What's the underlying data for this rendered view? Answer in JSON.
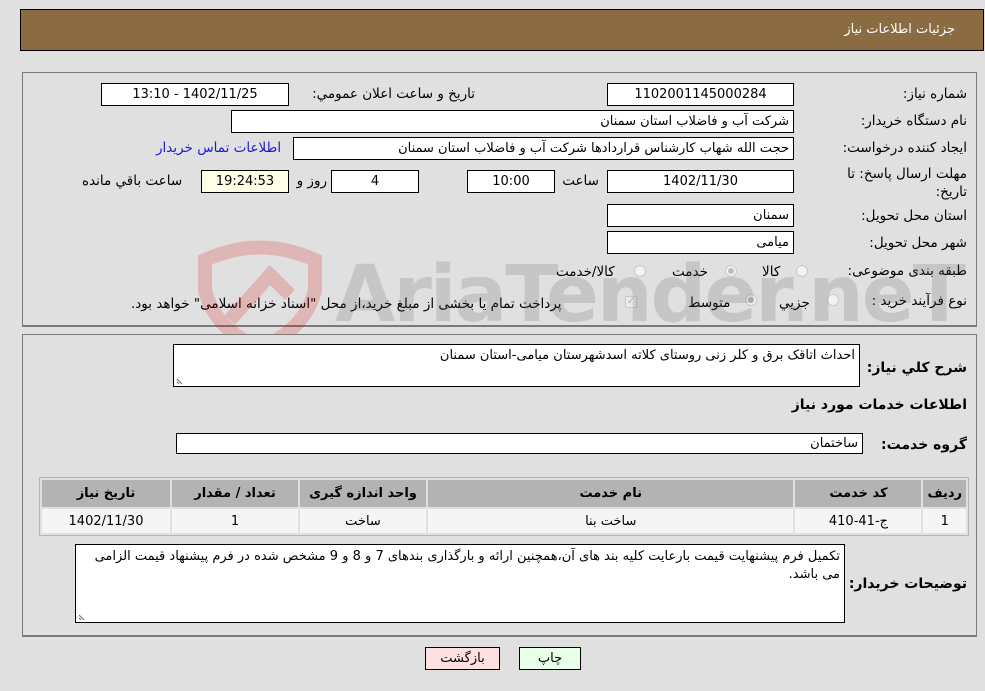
{
  "header": {
    "title": "جزئیات اطلاعات نیاز"
  },
  "details": {
    "need_number_label": "شماره نیاز:",
    "need_number": "1102001145000284",
    "announce_label": "تاریخ و ساعت اعلان عمومي:",
    "announce_value": "1402/11/25 - 13:10",
    "buyer_org_label": "نام دستگاه خریدار:",
    "buyer_org": "شرکت آب و فاضلاب استان سمنان",
    "requester_label": "ایجاد کننده درخواست:",
    "requester": "حجت الله شهاب کارشناس قراردادها شرکت آب و فاضلاب استان سمنان",
    "buyer_contact_link": "اطلاعات تماس خریدار",
    "deadline_label_line1": "مهلت ارسال پاسخ: تا",
    "deadline_label_line2": "تاریخ:",
    "deadline_date": "1402/11/30",
    "time_label": "ساعت",
    "deadline_time": "10:00",
    "days_value": "4",
    "days_label": "روز و",
    "remaining_time": "19:24:53",
    "remaining_label": "ساعت باقي مانده",
    "province_label": "استان محل تحویل:",
    "province": "سمنان",
    "city_label": "شهر محل تحویل:",
    "city": "میامی",
    "category_label": "طبقه بندی موضوعی:",
    "category_options": [
      {
        "label": "کالا",
        "checked": false
      },
      {
        "label": "خدمت",
        "checked": true
      },
      {
        "label": "کالا/خدمت",
        "checked": false
      }
    ],
    "process_label": "نوع فرآیند خرید :",
    "process_options": [
      {
        "label": "جزیي",
        "checked": false
      },
      {
        "label": "متوسط",
        "checked": true
      }
    ],
    "treasury_checkbox_checked": true,
    "treasury_note": "پرداخت تمام یا بخشی از مبلغ خرید،از محل \"اسناد خزانه اسلامی\" خواهد بود."
  },
  "description": {
    "label": "شرح کلي نیاز:",
    "text": "احداث اتاقک برق و کلر زنی روستای کلاته اسدشهرستان میامی-استان سمنان"
  },
  "services": {
    "section_title": "اطلاعات خدمات مورد نیاز",
    "group_label": "گروه خدمت:",
    "group_value": "ساختمان",
    "table": {
      "headers": [
        "ردیف",
        "کد خدمت",
        "نام خدمت",
        "واحد اندازه گیری",
        "تعداد / مقدار",
        "تاریخ نیاز"
      ],
      "rows": [
        [
          "1",
          "ج-41-410",
          "ساخت بنا",
          "ساخت",
          "1",
          "1402/11/30"
        ]
      ]
    }
  },
  "buyer_notes": {
    "label": "توضیحات خریدار:",
    "text": "تکمیل فرم پیشنهایت قیمت بارعایت کلیه بند های آن،همچنین ارائه و بارگذاری بندهای 7 و 8 و 9 مشخص شده در فرم پیشنهاد قیمت الزامی می باشد."
  },
  "buttons": {
    "print": "چاپ",
    "back": "بازگشت"
  },
  "watermark_text": "AriaTender.neT",
  "colors": {
    "header_bg": "#8b6c42",
    "back_button_bg": "#ffe0e0",
    "print_button_bg": "#e8ffe8",
    "link": "#1a1ad6"
  }
}
